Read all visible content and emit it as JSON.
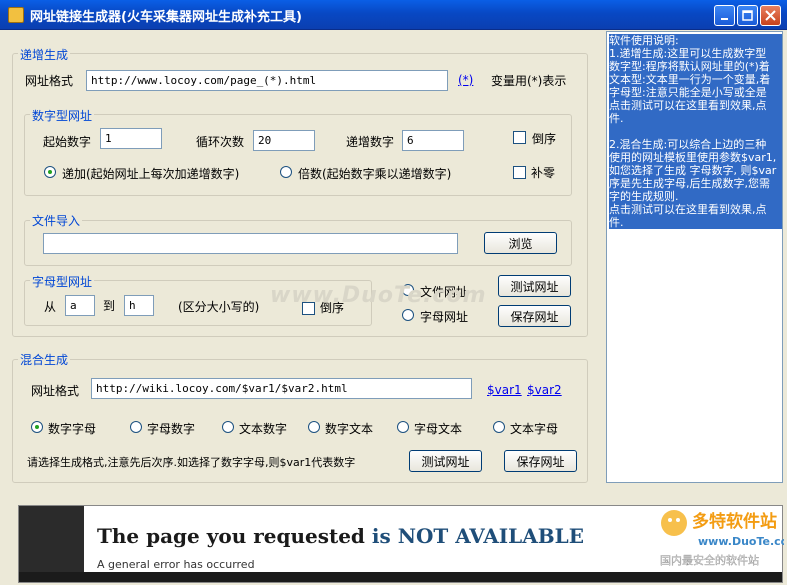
{
  "window": {
    "title": "网址链接生成器(火车采集器网址生成补充工具)"
  },
  "increment": {
    "group_label": "递增生成",
    "url_format_label": "网址格式",
    "url_format_value": "http://www.locoy.com/page_(*).html",
    "var_link": "(*)",
    "var_hint": "变量用(*)表示",
    "numeric": {
      "group_label": "数字型网址",
      "start_label": "起始数字",
      "start_value": "1",
      "loop_label": "循环次数",
      "loop_value": "20",
      "step_label": "递增数字",
      "step_value": "6",
      "reverse_label": "倒序",
      "add_label": "递加(起始网址上每次加递增数字)",
      "multiply_label": "倍数(起始数字乘以递增数字)",
      "zero_pad_label": "补零"
    },
    "file_import": {
      "group_label": "文件导入",
      "path_value": "",
      "browse_label": "浏览"
    },
    "alpha": {
      "group_label": "字母型网址",
      "from_label": "从",
      "from_value": "a",
      "to_label": "到",
      "to_value": "h",
      "case_hint": "(区分大小写的)",
      "reverse_label": "倒序"
    },
    "file_url_label": "文件网址",
    "alpha_url_label": "字母网址",
    "test_label": "测试网址",
    "save_label": "保存网址"
  },
  "mixed": {
    "group_label": "混合生成",
    "url_format_label": "网址格式",
    "url_format_value": "http://wiki.locoy.com/$var1/$var2.html",
    "var1_link": "$var1",
    "var2_link": "$var2",
    "options": [
      "数字字母",
      "字母数字",
      "文本数字",
      "数字文本",
      "字母文本",
      "文本字母"
    ],
    "selected": "数字字母",
    "hint": "请选择生成格式,注意先后次序.如选择了数字字母,则$var1代表数字",
    "test_label": "测试网址",
    "save_label": "保存网址"
  },
  "help_text": "软件使用说明:\n1.递增生成:这里可以生成数字型\n数字型:程序将默认网址里的(*)着\n文本型:文本里一行为一个变量,着\n字母型:注意只能全是小写或全是\n点击测试可以在这里看到效果,点\n件.\n\n2.混合生成:可以综合上边的三种\n使用的网址模板里使用参数$var1,\n如您选择了生成 字母数字, 则$var\n序是先生成字母,后生成数字,您需\n字的生成规则.\n点击测试可以在这里看到效果,点\n件.",
  "browser": {
    "heading_part1": "The page you requested ",
    "heading_part2": "is NOT AVAILABLE",
    "subtext": "A general error has occurred"
  },
  "watermarks": {
    "center": "www.DuoTe.com",
    "logo_cn": "多特软件站",
    "logo_url": "www.DuoTe.com",
    "logo_slogan": "国内最安全的软件站"
  }
}
